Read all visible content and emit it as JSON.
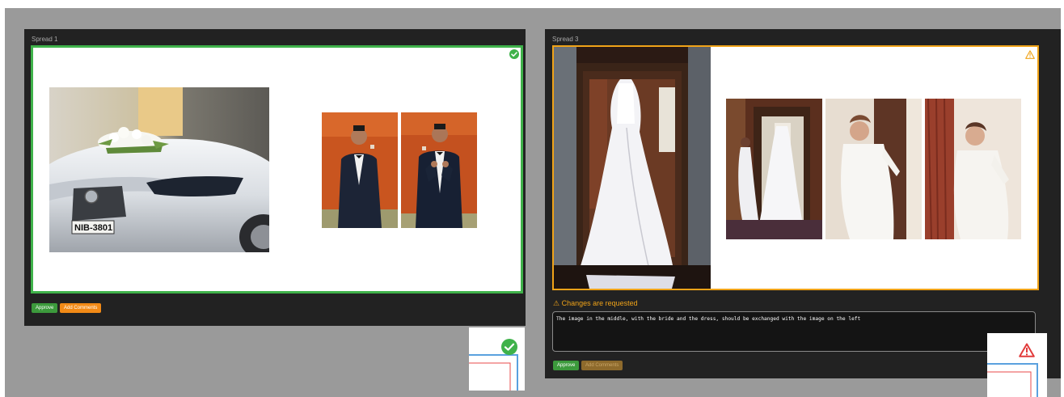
{
  "spreads": [
    {
      "label": "Spread 1",
      "status": "approved",
      "approve_label": "Approve",
      "comment_label": "Add Comments"
    },
    {
      "label": "Spread 3",
      "status": "changes-requested",
      "changes_message": "⚠ Changes are requested",
      "comment_text": "The image in the middle, with the bride and the dress, should be exchanged with the image on the left",
      "approve_label": "Approve",
      "comment_label": "Add Comments"
    }
  ],
  "colors": {
    "approved": "#3fb24a",
    "warning": "#f0a318",
    "panel": "#222222",
    "background": "#9a9a9a"
  },
  "icons": {
    "approved": "check-circle-icon",
    "warning": "warning-triangle-icon"
  }
}
